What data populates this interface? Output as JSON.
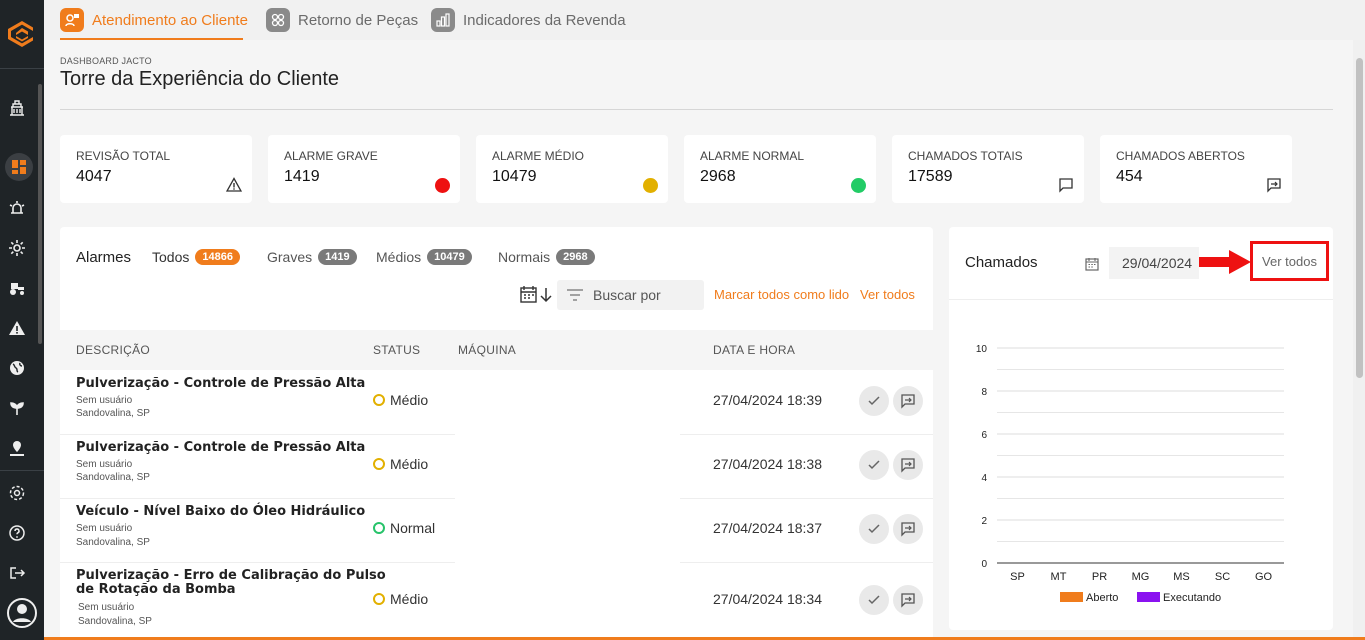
{
  "tabs": [
    {
      "label": "Atendimento ao Cliente",
      "active": true
    },
    {
      "label": "Retorno de Peças",
      "active": false
    },
    {
      "label": "Indicadores da Revenda",
      "active": false
    }
  ],
  "page": {
    "subtitle": "DASHBOARD JACTO",
    "title": "Torre da Experiência do Cliente"
  },
  "cards": [
    {
      "label": "REVISÃO TOTAL",
      "value": "4047",
      "icon": "warning-icon"
    },
    {
      "label": "ALARME GRAVE",
      "value": "1419",
      "icon": "red-dot-icon",
      "color": "#ee1111"
    },
    {
      "label": "ALARME MÉDIO",
      "value": "10479",
      "icon": "yellow-dot-icon",
      "color": "#e2b000"
    },
    {
      "label": "ALARME NORMAL",
      "value": "2968",
      "icon": "green-dot-icon",
      "color": "#22cc66"
    },
    {
      "label": "CHAMADOS TOTAIS",
      "value": "17589",
      "icon": "chat-icon"
    },
    {
      "label": "CHAMADOS ABERTOS",
      "value": "454",
      "icon": "open-ticket-icon"
    }
  ],
  "alarms": {
    "title": "Alarmes",
    "filters": [
      {
        "label": "Todos",
        "count": "14866"
      },
      {
        "label": "Graves",
        "count": "1419"
      },
      {
        "label": "Médios",
        "count": "10479"
      },
      {
        "label": "Normais",
        "count": "2968"
      }
    ],
    "search_placeholder": "Buscar por",
    "mark_all_read": "Marcar todos como lido",
    "see_all": "Ver todos",
    "columns": [
      "DESCRIÇÃO",
      "STATUS",
      "MÁQUINA",
      "DATA E HORA"
    ],
    "rows": [
      {
        "title": "Pulverização - Controle de Pressão Alta",
        "title2": "",
        "user": "Sem usuário",
        "location": "Sandovalina, SP",
        "status": "Médio",
        "datetime": "27/04/2024 18:39"
      },
      {
        "title": "Pulverização - Controle de Pressão Alta",
        "title2": "",
        "user": "Sem usuário",
        "location": "Sandovalina, SP",
        "status": "Médio",
        "datetime": "27/04/2024 18:38"
      },
      {
        "title": "Veículo - Nível Baixo do Óleo Hidráulico",
        "title2": "",
        "user": "Sem usuário",
        "location": "Sandovalina, SP",
        "status": "Normal",
        "datetime": "27/04/2024 18:37"
      },
      {
        "title": "Pulverização - Erro de Calibração do Pulso",
        "title2": "de Rotação da Bomba",
        "user": "Sem usuário",
        "location": "Sandovalina, SP",
        "status": "Médio",
        "datetime": "27/04/2024 18:34"
      }
    ]
  },
  "chamados": {
    "title": "Chamados",
    "date": "29/04/2024",
    "see_all": "Ver todos"
  },
  "chart_data": {
    "type": "bar",
    "categories": [
      "SP",
      "MT",
      "PR",
      "MG",
      "MS",
      "SC",
      "GO"
    ],
    "series": [
      {
        "name": "Aberto",
        "color": "#f07c1c",
        "values": [
          0,
          0,
          0,
          0,
          0,
          0,
          0
        ]
      },
      {
        "name": "Executando",
        "color": "#8a12f0",
        "values": [
          0,
          0,
          0,
          0,
          0,
          0,
          0
        ]
      }
    ],
    "yticks": [
      "0",
      "2",
      "4",
      "6",
      "8",
      "10"
    ],
    "ylim": [
      0,
      10
    ],
    "legend": "bottom"
  }
}
